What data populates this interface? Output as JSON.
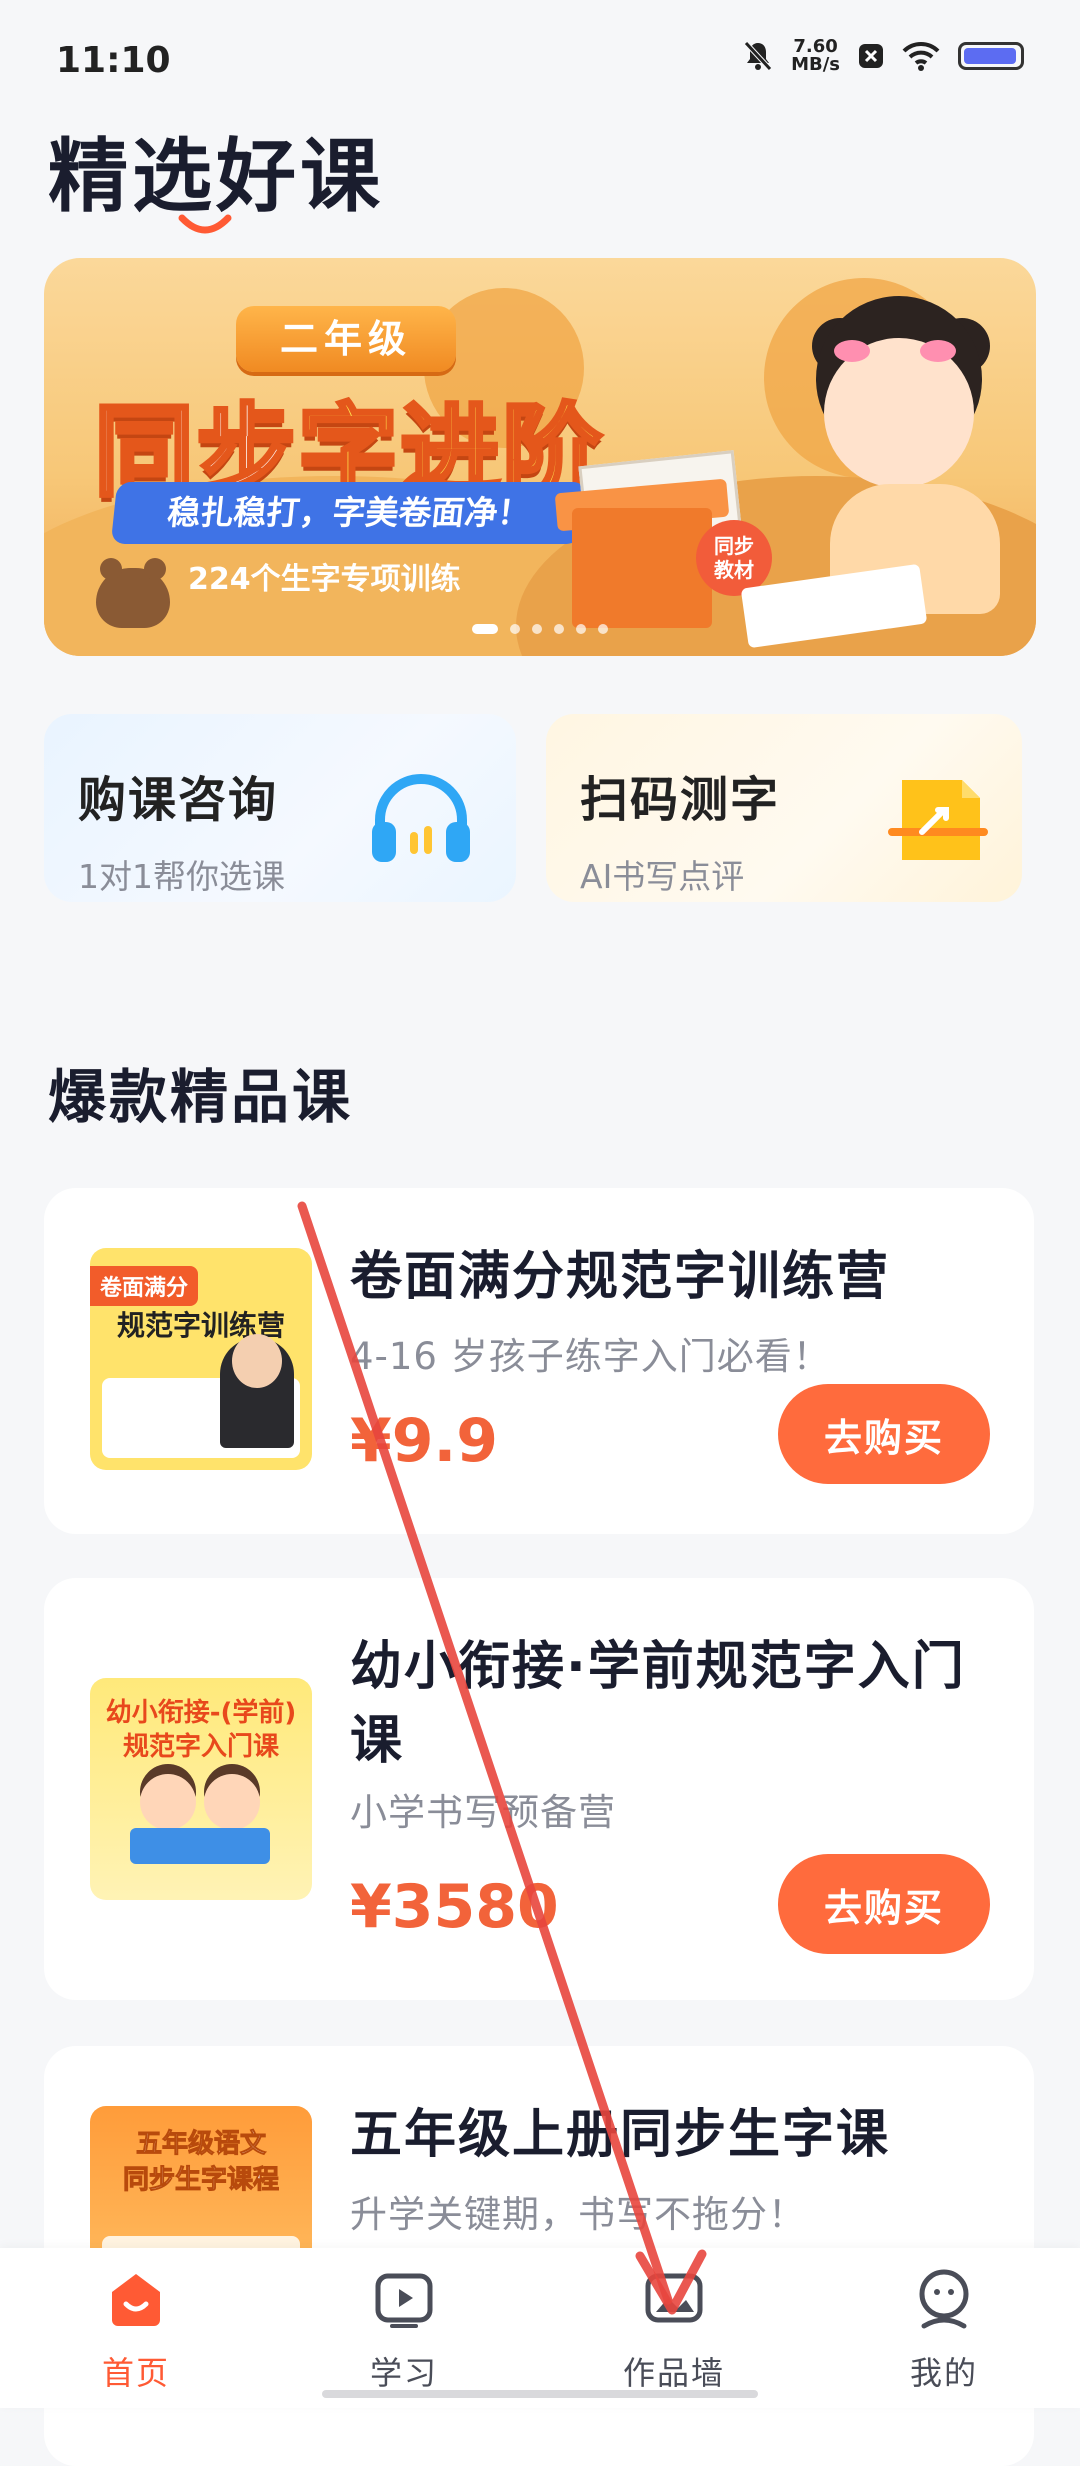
{
  "status": {
    "time": "11:10",
    "net_speed_value": "7.60",
    "net_speed_unit": "MB/s"
  },
  "page_title": "精选好课",
  "banner": {
    "grade": "二年级",
    "headline_part1": "同步",
    "headline_part2": "字进阶",
    "slogan": "稳扎稳打，字美卷面净！",
    "sub": "224个生字专项训练",
    "badge": "同步\n教材",
    "slide_count": 6,
    "active_slide": 0
  },
  "quick_actions": [
    {
      "title": "购课咨询",
      "subtitle": "1对1帮你选课",
      "icon": "headset-icon"
    },
    {
      "title": "扫码测字",
      "subtitle": "AI书写点评",
      "icon": "scan-icon"
    }
  ],
  "section_title": "爆款精品课",
  "courses": [
    {
      "title": "卷面满分规范字训练营",
      "subtitle": "4-16 岁孩子练字入门必看！",
      "price": "¥9.9",
      "button": "去购买",
      "thumb_tag": "卷面满分",
      "thumb_title": "规范字训练营"
    },
    {
      "title": "幼小衔接·学前规范字入门课",
      "subtitle": "小学书写预备营",
      "price": "¥3580",
      "button": "去购买",
      "thumb_title": "幼小衔接-(学前)\n规范字入门课"
    },
    {
      "title": "五年级上册同步生字课",
      "subtitle": "升学关键期，书写不拖分！",
      "thumb_title": "五年级语文\n同步生字课程"
    }
  ],
  "tabs": [
    {
      "label": "首页",
      "icon": "home-icon",
      "active": true
    },
    {
      "label": "学习",
      "icon": "play-tv-icon",
      "active": false
    },
    {
      "label": "作品墙",
      "icon": "gallery-icon",
      "active": false
    },
    {
      "label": "我的",
      "icon": "profile-icon",
      "active": false
    }
  ],
  "colors": {
    "accent": "#ff6b3d",
    "price": "#f2633a",
    "active_tab": "#ff5a34",
    "annotation_arrow": "#e8463e"
  }
}
